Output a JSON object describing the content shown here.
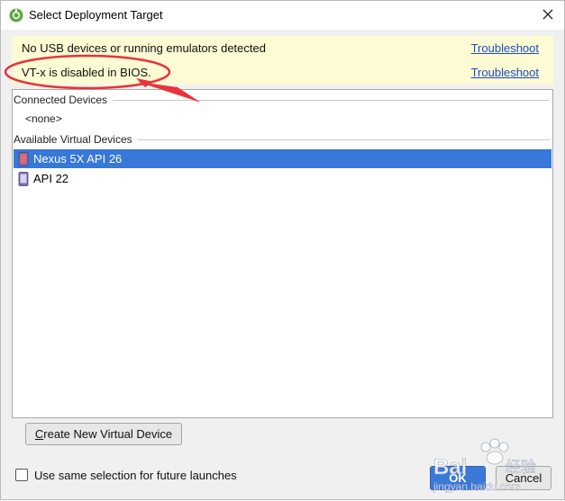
{
  "window": {
    "title": "Select Deployment Target"
  },
  "warnings": [
    {
      "message": "No USB devices or running emulators detected",
      "link": "Troubleshoot"
    },
    {
      "message": "VT-x is disabled in BIOS.",
      "link": "Troubleshoot"
    }
  ],
  "device_list": {
    "connected_header": "Connected Devices",
    "connected_none": "<none>",
    "available_header": "Available Virtual Devices",
    "available": [
      {
        "name": "Nexus 5X API 26",
        "selected": true
      },
      {
        "name": "API 22",
        "selected": false
      }
    ]
  },
  "buttons": {
    "create_mnemonic": "C",
    "create_rest": "reate New Virtual Device",
    "ok": "OK",
    "cancel": "Cancel"
  },
  "checkbox": {
    "label": "Use same selection for future launches",
    "checked": false
  },
  "colors": {
    "warning_bg": "#fcfbd3",
    "selection": "#3778d8",
    "link": "#1e49c9",
    "annotation": "#e8333b"
  },
  "icons": {
    "app": "android-studio-icon",
    "close": "close-icon",
    "device": "phone-icon"
  },
  "watermark": {
    "text_a": "Bai",
    "text_b": "经验",
    "url": "jingyan.baidu.com"
  }
}
